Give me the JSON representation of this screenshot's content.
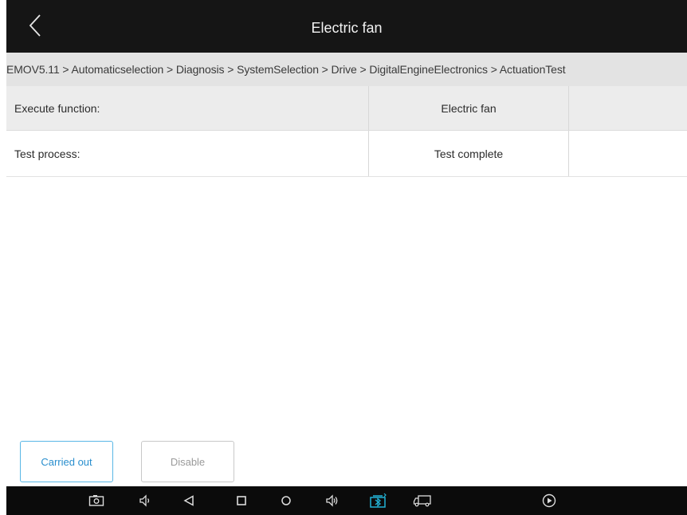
{
  "header": {
    "title": "Electric fan",
    "back_icon": "chevron-left-icon"
  },
  "breadcrumb": {
    "text": "EMOV5.11 > Automaticselection > Diagnosis > SystemSelection > Drive > DigitalEngineElectronics > ActuationTest"
  },
  "table": {
    "rows": [
      {
        "label": "Execute function:",
        "value": "Electric fan",
        "extra": ""
      },
      {
        "label": "Test process:",
        "value": "Test complete",
        "extra": ""
      }
    ]
  },
  "buttons": {
    "carried_out": "Carried out",
    "disable": "Disable"
  },
  "navbar": {
    "icons": [
      "screenshot-icon",
      "volume-down-icon",
      "back-icon",
      "home-icon",
      "circle-icon",
      "volume-up-icon",
      "vci-bluetooth-icon",
      "truck-icon",
      "play-icon"
    ]
  },
  "colors": {
    "topbar": "#151515",
    "breadcrumb_bg": "#e3e3e3",
    "accent": "#2a8fce",
    "vci_icon": "#23b3d6"
  }
}
